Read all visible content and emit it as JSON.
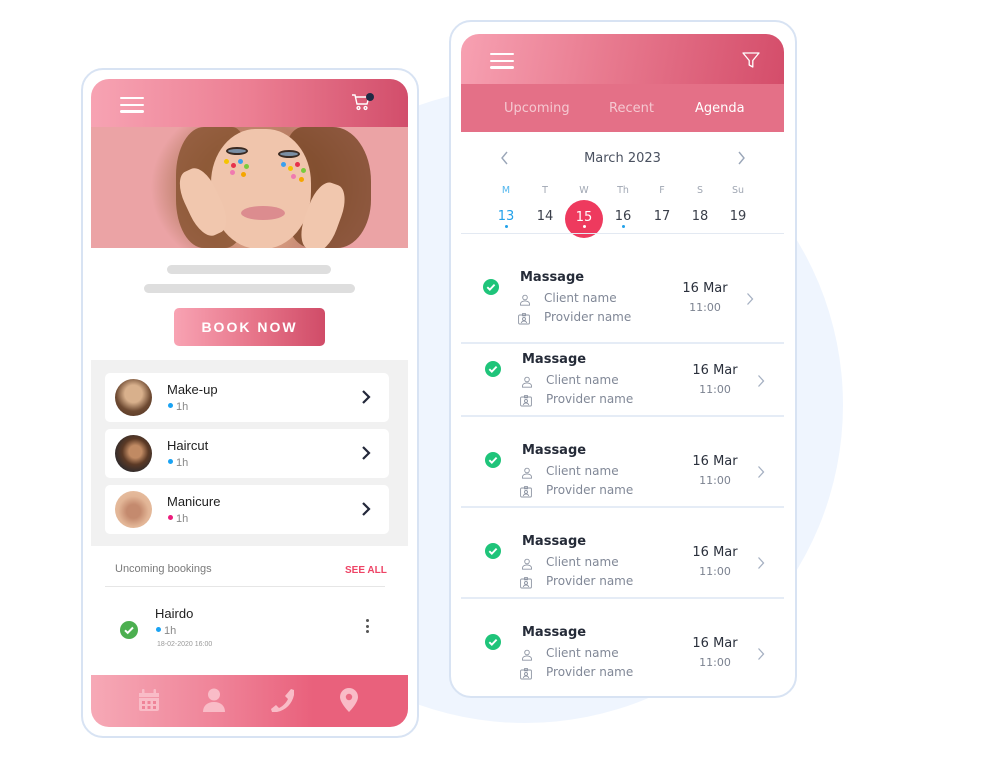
{
  "colors": {
    "brand_pink": "#e9617c",
    "accent_red": "#ee3a5e",
    "check_green": "#1fc47a",
    "booking_check_green": "#4caf50",
    "today_blue": "#23a2ea",
    "background_circle": "#eff5fe"
  },
  "left_app": {
    "header": {
      "menu_icon": "hamburger-icon",
      "cart_icon": "cart-icon",
      "cart_badge": true
    },
    "hero_image": "woman-with-colorful-dots-makeup",
    "book_button": "BOOK NOW",
    "services": [
      {
        "name": "Make-up",
        "duration": "1h",
        "dot_color": "#1aa3f3",
        "avatar": "make-up-model"
      },
      {
        "name": "Haircut",
        "duration": "1h",
        "dot_color": "#1aa3f3",
        "avatar": "haircut-client"
      },
      {
        "name": "Manicure",
        "duration": "1h",
        "dot_color": "#ec1c7c",
        "avatar": "manicure-hands"
      }
    ],
    "upcoming": {
      "label": "Uncoming bookings",
      "see_all": "SEE ALL",
      "bookings": [
        {
          "name": "Hairdo",
          "duration": "1h",
          "datetime": "18-02-2020 16:00",
          "status": "confirmed"
        }
      ]
    },
    "bottom_nav": [
      {
        "icon": "calendar-icon"
      },
      {
        "icon": "user-icon"
      },
      {
        "icon": "phone-icon"
      },
      {
        "icon": "location-pin-icon"
      }
    ]
  },
  "right_app": {
    "header": {
      "menu_icon": "hamburger-icon",
      "filter_icon": "filter-icon"
    },
    "tabs": [
      {
        "label": "Upcoming",
        "active": false
      },
      {
        "label": "Recent",
        "active": false
      },
      {
        "label": "Agenda",
        "active": true
      }
    ],
    "calendar": {
      "month": "March 2023",
      "weekdays": [
        "M",
        "T",
        "W",
        "Th",
        "F",
        "S",
        "Su"
      ],
      "days": [
        {
          "day": "13",
          "today": true,
          "mark": true
        },
        {
          "day": "14",
          "today": false,
          "mark": false
        },
        {
          "day": "15",
          "selected": true,
          "mark": true
        },
        {
          "day": "16",
          "today": false,
          "mark": true
        },
        {
          "day": "17",
          "today": false,
          "mark": false
        },
        {
          "day": "18",
          "today": false,
          "mark": false
        },
        {
          "day": "19",
          "today": false,
          "mark": false
        }
      ]
    },
    "appointments": [
      {
        "title": "Massage",
        "client": "Client name",
        "provider": "Provider name",
        "date": "16 Mar",
        "time": "11:00",
        "status": "confirmed"
      },
      {
        "title": "Massage",
        "client": "Client name",
        "provider": "Provider name",
        "date": "16 Mar",
        "time": "11:00",
        "status": "confirmed"
      },
      {
        "title": "Massage",
        "client": "Client name",
        "provider": "Provider name",
        "date": "16 Mar",
        "time": "11:00",
        "status": "confirmed"
      },
      {
        "title": "Massage",
        "client": "Client name",
        "provider": "Provider name",
        "date": "16 Mar",
        "time": "11:00",
        "status": "confirmed"
      },
      {
        "title": "Massage",
        "client": "Client name",
        "provider": "Provider name",
        "date": "16 Mar",
        "time": "11:00",
        "status": "confirmed"
      }
    ]
  }
}
